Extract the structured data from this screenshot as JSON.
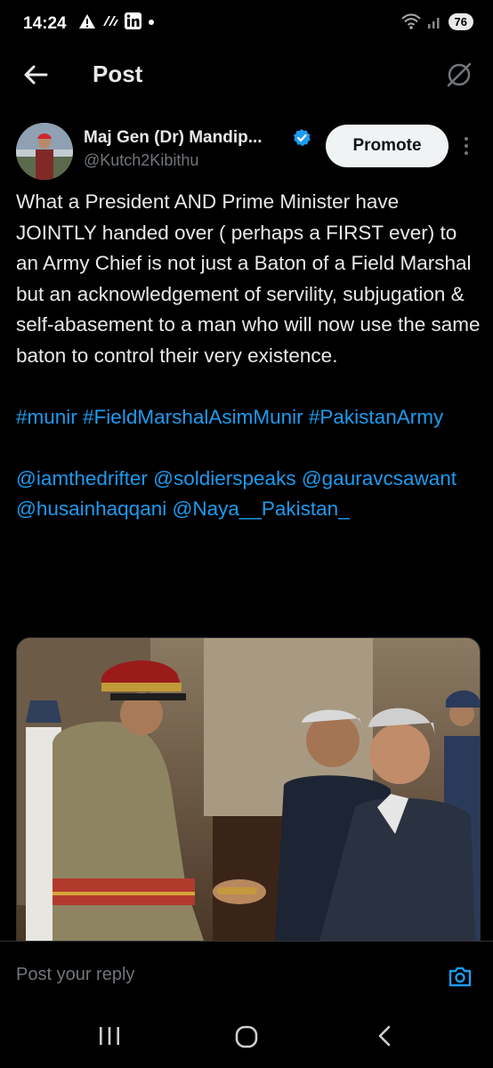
{
  "status_bar": {
    "time": "14:24",
    "battery": "76"
  },
  "header": {
    "title": "Post"
  },
  "post": {
    "author_name": "Maj Gen (Dr) Mandip...",
    "handle": "@Kutch2Kibithu",
    "promote_label": "Promote",
    "body": "What a President AND Prime Minister have JOINTLY handed over ( perhaps a FIRST ever) to an Army Chief is not just a Baton of a Field Marshal but an acknowledgement of servility, subjugation & self-abasement to a man who will now use the same baton to control their very existence.",
    "hashtags": [
      "#munir",
      "#FieldMarshalAsimMunir",
      "#PakistanArmy"
    ],
    "mentions": [
      "@iamthedrifter",
      "@soldierspeaks",
      "@gauravcsawant",
      "@husainhaqqani",
      "@Naya__Pakistan_"
    ]
  },
  "reply": {
    "placeholder": "Post your reply"
  },
  "colors": {
    "background": "#000000",
    "link": "#1d9bf0",
    "secondary_text": "#71767b",
    "verified": "#1d9bf0"
  }
}
